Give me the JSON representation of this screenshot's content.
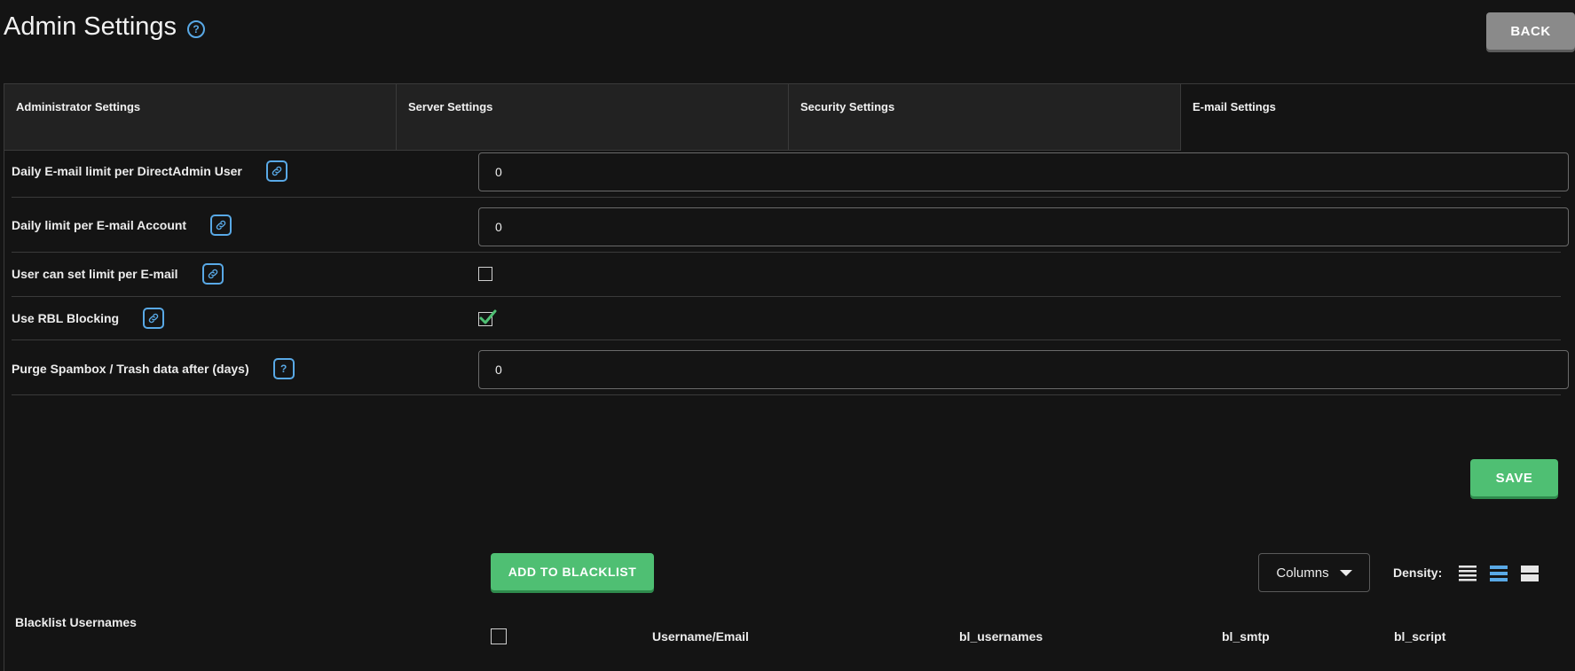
{
  "header": {
    "title": "Admin Settings",
    "help_icon": "question-circle-icon",
    "back_label": "BACK"
  },
  "tabs": [
    {
      "label": "Administrator Settings",
      "active": false
    },
    {
      "label": "Server Settings",
      "active": false
    },
    {
      "label": "Security Settings",
      "active": false
    },
    {
      "label": "E-mail Settings",
      "active": true
    }
  ],
  "settings": {
    "daily_limit_user": {
      "label": "Daily E-mail limit per DirectAdmin User",
      "value": "0",
      "icon": "link-icon"
    },
    "daily_limit_account": {
      "label": "Daily limit per E-mail Account",
      "value": "0",
      "icon": "link-icon"
    },
    "user_can_set_limit": {
      "label": "User can set limit per E-mail",
      "checked": false,
      "icon": "link-icon"
    },
    "use_rbl": {
      "label": "Use RBL Blocking",
      "checked": true,
      "icon": "link-icon"
    },
    "purge_spambox": {
      "label": "Purge Spambox / Trash data after (days)",
      "value": "0",
      "icon": "question-icon",
      "icon_text": "?"
    }
  },
  "save_label": "SAVE",
  "blacklist": {
    "label": "Blacklist Usernames",
    "add_label": "ADD TO BLACKLIST",
    "columns_label": "Columns",
    "density_label": "Density:",
    "headers": [
      "Username/Email",
      "bl_usernames",
      "bl_smtp",
      "bl_script"
    ]
  },
  "colors": {
    "background": "#141414",
    "accent_blue": "#59a9e6",
    "accent_green": "#4fbf73",
    "back_gray": "#8a8a8a"
  }
}
